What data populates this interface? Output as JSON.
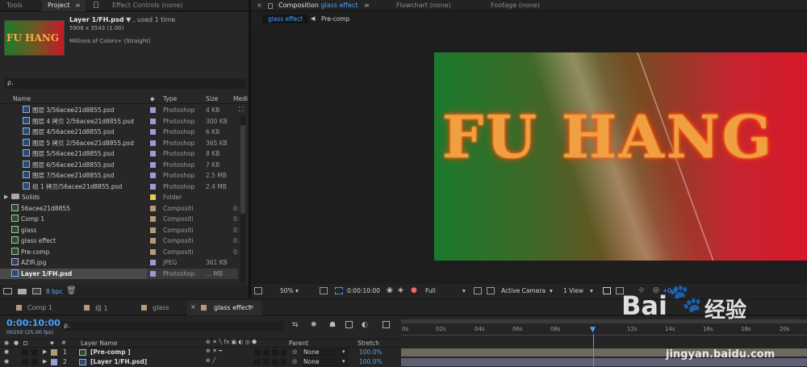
{
  "left_tabs": {
    "tools": "Tools",
    "project": "Project",
    "effect_controls": "Effect Controls (none)"
  },
  "preview": {
    "thumb_text": "FU HANG",
    "name": "Layer 1/FH.psd",
    "used": ", used 1 time",
    "dims": "5906 x 3543 (1.00)",
    "colors": "Millions of Colors+ (Straight)"
  },
  "search": {
    "placeholder": "ρ."
  },
  "columns": {
    "name": "Name",
    "type": "Type",
    "size": "Size",
    "media": "Medi"
  },
  "items": [
    {
      "name": "图层 3/56acee21d8855.psd",
      "type": "Photoshop",
      "size": "4 KB",
      "icon": "psd-file-icon"
    },
    {
      "name": "图层 4 拷贝 2/56acee21d8855.psd",
      "type": "Photoshop",
      "size": "300 KB",
      "icon": "psd-file-icon"
    },
    {
      "name": "图层 4/56acee21d8855.psd",
      "type": "Photoshop",
      "size": "6 KB",
      "icon": "psd-file-icon"
    },
    {
      "name": "图层 5 拷贝 2/56acee21d8855.psd",
      "type": "Photoshop",
      "size": "365 KB",
      "icon": "psd-file-icon"
    },
    {
      "name": "图层 5/56acee21d8855.psd",
      "type": "Photoshop",
      "size": "8 KB",
      "icon": "psd-file-icon"
    },
    {
      "name": "图层 6/56acee21d8855.psd",
      "type": "Photoshop",
      "size": "7 KB",
      "icon": "psd-file-icon"
    },
    {
      "name": "图层 7/56acee21d8855.psd",
      "type": "Photoshop",
      "size": "2.5 MB",
      "icon": "psd-file-icon"
    },
    {
      "name": "组 1 拷贝/56acee21d8855.psd",
      "type": "Photoshop",
      "size": "2.4 MB",
      "icon": "psd-file-icon"
    },
    {
      "name": "Solids",
      "type": "Folder",
      "size": "",
      "icon": "folder-icon"
    },
    {
      "name": "56acee21d8855",
      "type": "Compositi",
      "size": "",
      "icon": "composition-icon"
    },
    {
      "name": "Comp 1",
      "type": "Compositi",
      "size": "",
      "icon": "composition-icon"
    },
    {
      "name": "glass",
      "type": "Compositi",
      "size": "",
      "icon": "composition-icon"
    },
    {
      "name": "glass effect",
      "type": "Compositi",
      "size": "",
      "icon": "composition-icon"
    },
    {
      "name": "Pre-comp",
      "type": "Compositi",
      "size": "",
      "icon": "composition-icon"
    },
    {
      "name": "AZIR.jpg",
      "type": "JPEG",
      "size": "361 KB",
      "icon": "image-file-icon"
    },
    {
      "name": "Layer 1/FH.psd",
      "type": "Photoshop",
      "size": "... MB",
      "icon": "psd-file-icon"
    }
  ],
  "project_bottom": {
    "bpc": "8 bpc"
  },
  "comp_tabs": {
    "composition_prefix": "Composition",
    "composition_name": "glass effect",
    "flowchart": "Flowchart (none)",
    "footage": "Footage (none)"
  },
  "breadcrumb": {
    "current": "glass effect",
    "parent": "Pre-comp"
  },
  "canvas": {
    "text": "FU HANG"
  },
  "viewer_bar": {
    "zoom": "50%",
    "timecode": "0:00:10:00",
    "resolution": "Full",
    "camera": "Active Camera",
    "views": "1 View",
    "offset": "+0.0"
  },
  "timeline_tabs": [
    "Comp 1",
    "组 1",
    "glass",
    "glass effect"
  ],
  "timeline": {
    "timecode": "0:00:10:00",
    "fps": "00250 (25.00 fps)",
    "search_placeholder": "ρ.",
    "layer_name_header": "Layer Name",
    "parent_header": "Parent",
    "stretch_header": "Stretch"
  },
  "ruler": [
    "0s",
    "02s",
    "04s",
    "06s",
    "08s",
    "12s",
    "14s",
    "16s",
    "18s",
    "20s"
  ],
  "layers": [
    {
      "num": "1",
      "name": "[Pre-comp ]",
      "parent": "None",
      "stretch": "100.0%"
    },
    {
      "num": "2",
      "name": "[Layer 1/FH.psd]",
      "parent": "None",
      "stretch": "100.0%"
    }
  ],
  "watermark": {
    "brand": "Bai",
    "brand2": "经验",
    "url": "jingyan.baidu.com"
  },
  "colors": {
    "accent_blue": "#4aa0ff",
    "label_lavender": "#9b9bd6",
    "label_yellow": "#e6c84a",
    "label_tan": "#b59a7a"
  }
}
